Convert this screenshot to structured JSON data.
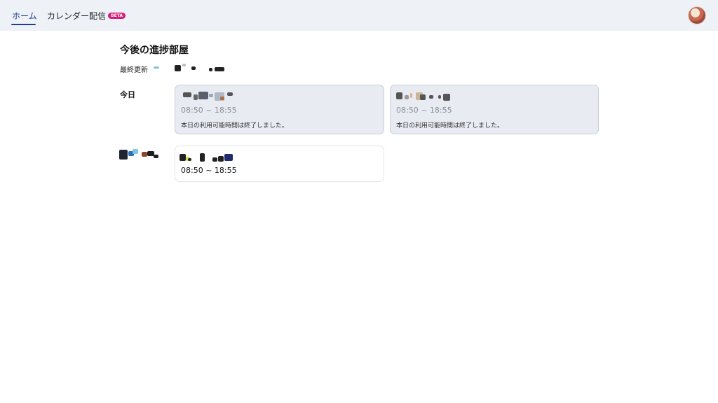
{
  "nav": {
    "tabs": [
      {
        "label": "ホーム",
        "active": true
      },
      {
        "label": "カレンダー配信",
        "badge": "BETA"
      }
    ]
  },
  "main": {
    "title": "今後の進捗部屋",
    "last_updated_label": "最終更新",
    "days": [
      {
        "label": "今日",
        "rooms": [
          {
            "time": "08:50 ~ 18:55",
            "note": "本日の利用可能時間は終了しました。",
            "ended": true
          },
          {
            "time": "08:50 ~ 18:55",
            "note": "本日の利用可能時間は終了しました。",
            "ended": true
          }
        ]
      },
      {
        "label": "",
        "rooms": [
          {
            "time": "08:50 ~ 18:55",
            "ended": false
          }
        ]
      }
    ]
  },
  "colors": {
    "accent": "#1f3f8f",
    "topbar_bg": "#eef1f6",
    "ended_card_bg": "#e8ebf1",
    "badge": "#d81b78"
  },
  "icons": {
    "avatar": "user-avatar"
  }
}
